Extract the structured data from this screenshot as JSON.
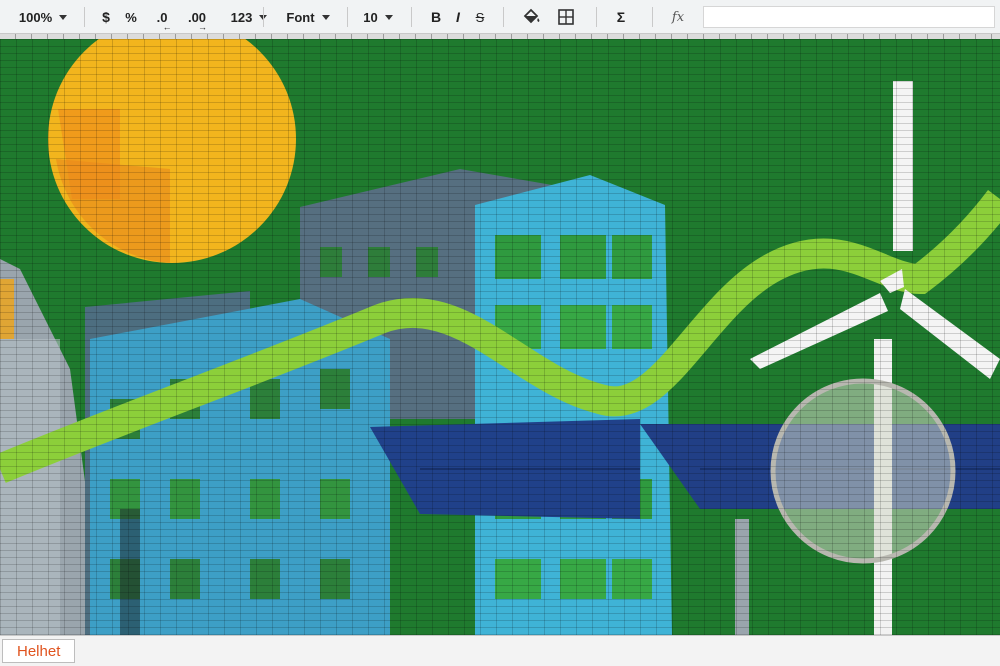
{
  "toolbar": {
    "zoom": "100%",
    "currency": "$",
    "percent": "%",
    "decrease_decimals": ".0",
    "increase_decimals": ".00",
    "number_format": "123",
    "font": "Font",
    "font_size": "10",
    "bold": "B",
    "italic": "I",
    "strikethrough": "S",
    "functions": "Σ",
    "formula_label": "fx",
    "formula_value": ""
  },
  "icons": {
    "fill_color": "paint-bucket-icon",
    "borders": "borders-icon"
  },
  "sheet_tabs": [
    {
      "label": "Helhet",
      "active": true
    }
  ],
  "colors": {
    "background_green": "#1f7a2e",
    "sun": "#f2b51d",
    "building_cyan": "#3fb3d6",
    "ribbon_green": "#8ccf3a",
    "solar_blue": "#20418a",
    "turbine_white": "#f4f4f4",
    "tab_text": "#e0531e"
  }
}
